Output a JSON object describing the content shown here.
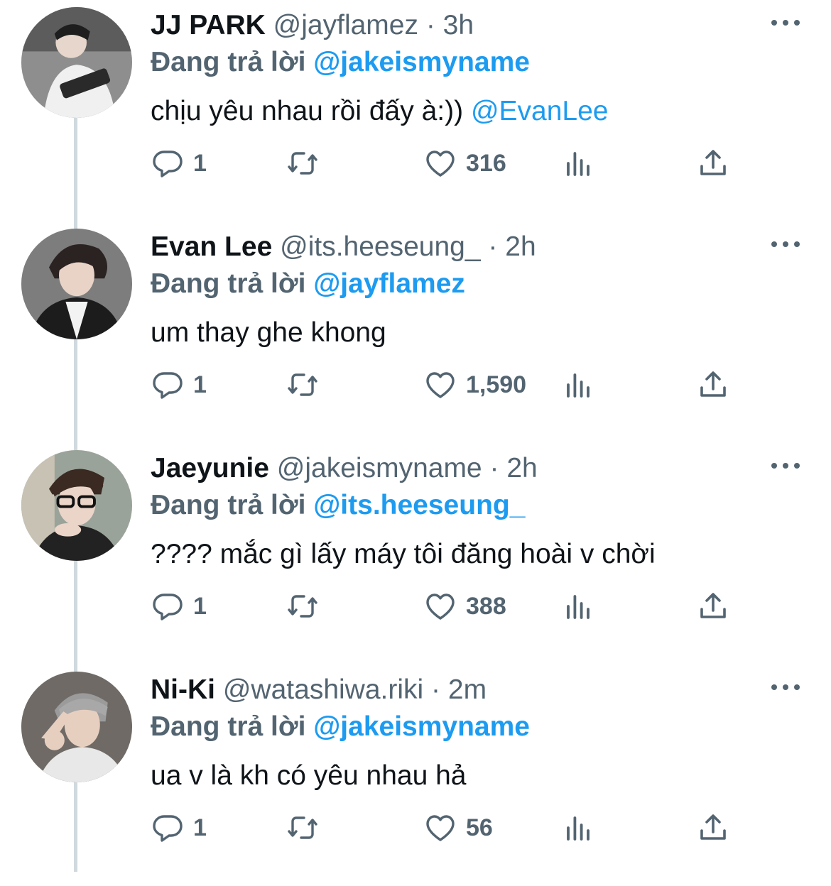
{
  "tweets": [
    {
      "name": "JJ PARK",
      "handle": "@jayflamez",
      "sep": "·",
      "time": "3h",
      "reply_prefix": "Đang trả lời",
      "reply_to": "@jakeismyname",
      "text": "chịu yêu nhau rồi đấy à:))",
      "text_mention": "@EvanLee",
      "replies": "1",
      "likes": "316"
    },
    {
      "name": "Evan Lee",
      "handle": "@its.heeseung_",
      "sep": "·",
      "time": "2h",
      "reply_prefix": "Đang trả lời",
      "reply_to": "@jayflamez",
      "text": "um thay ghe khong",
      "text_mention": "",
      "replies": "1",
      "likes": "1,590"
    },
    {
      "name": "Jaeyunie",
      "handle": "@jakeismyname",
      "sep": "·",
      "time": "2h",
      "reply_prefix": "Đang trả lời",
      "reply_to": "@its.heeseung_",
      "text": "???? mắc gì lấy máy tôi đăng hoài v chời",
      "text_mention": "",
      "replies": "1",
      "likes": "388"
    },
    {
      "name": "Ni-Ki",
      "handle": "@watashiwa.riki",
      "sep": "·",
      "time": "2m",
      "reply_prefix": "Đang trả lời",
      "reply_to": "@jakeismyname",
      "text": "ua v là kh có yêu nhau hả",
      "text_mention": "",
      "replies": "1",
      "likes": "56"
    }
  ],
  "icons": {
    "reply": "reply-icon",
    "retweet": "retweet-icon",
    "like": "like-icon",
    "views": "views-icon",
    "share": "share-icon",
    "more": "more-icon"
  },
  "colors": {
    "mention": "#1d9bf0",
    "muted": "#536471",
    "text": "#0f1419",
    "thread_line": "#cfd9de"
  }
}
